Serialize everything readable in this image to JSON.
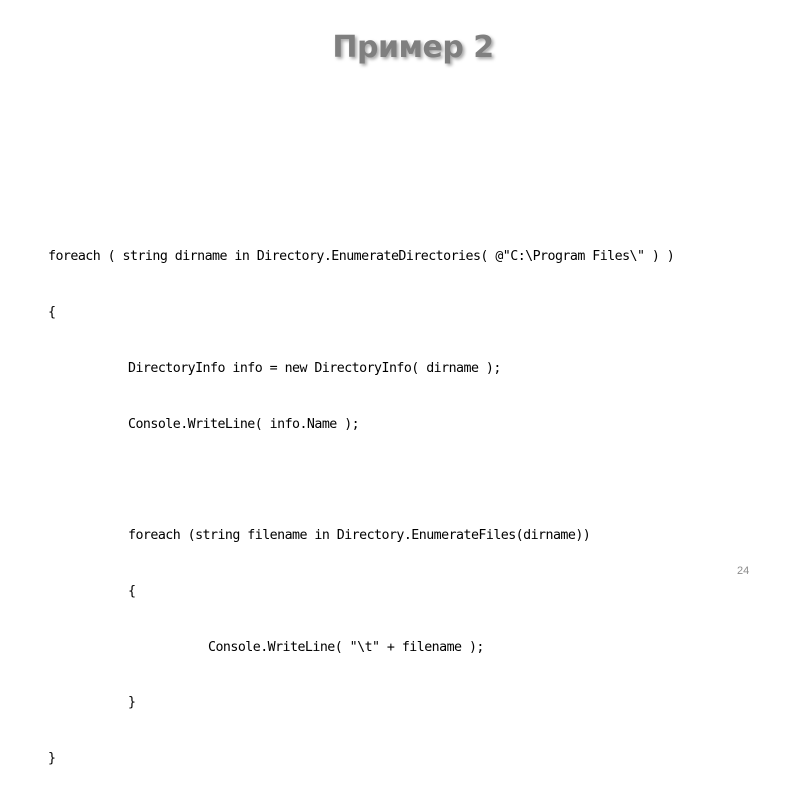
{
  "slide": {
    "title": "Пример 2",
    "page_number": "24"
  },
  "code": {
    "lines": [
      {
        "indent": 0,
        "text": "foreach ( string dirname in Directory.EnumerateDirectories( @\"C:\\Program Files\\\" ) )"
      },
      {
        "indent": 0,
        "text": "{"
      },
      {
        "indent": 1,
        "text": "DirectoryInfo info = new DirectoryInfo( dirname );"
      },
      {
        "indent": 1,
        "text": "Console.WriteLine( info.Name );"
      },
      {
        "indent": 0,
        "text": ""
      },
      {
        "indent": 1,
        "text": "foreach (string filename in Directory.EnumerateFiles(dirname))"
      },
      {
        "indent": 1,
        "text": "{"
      },
      {
        "indent": 2,
        "text": "Console.WriteLine( \"\\t\" + filename );"
      },
      {
        "indent": 1,
        "text": "}"
      },
      {
        "indent": 0,
        "text": "}"
      }
    ]
  }
}
